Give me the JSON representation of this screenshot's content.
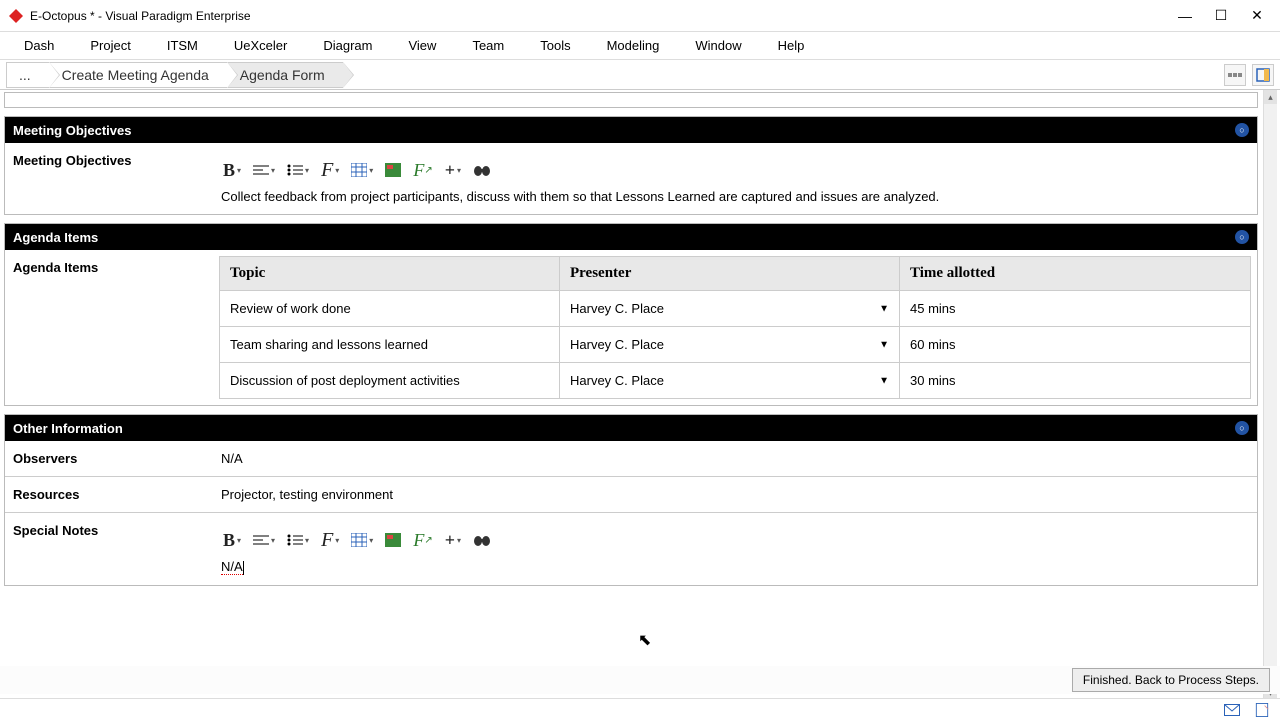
{
  "window": {
    "title": "E-Octopus * - Visual Paradigm Enterprise"
  },
  "menu": {
    "items": [
      "Dash",
      "Project",
      "ITSM",
      "UeXceler",
      "Diagram",
      "View",
      "Team",
      "Tools",
      "Modeling",
      "Window",
      "Help"
    ]
  },
  "breadcrumb": {
    "ellipsis": "...",
    "items": [
      "Create Meeting Agenda",
      "Agenda Form"
    ]
  },
  "sections": {
    "objectives": {
      "title": "Meeting Objectives",
      "label": "Meeting Objectives",
      "text": "Collect feedback from project participants, discuss with them so that Lessons Learned are captured and issues are analyzed."
    },
    "agenda": {
      "title": "Agenda Items",
      "label": "Agenda Items",
      "columns": {
        "topic": "Topic",
        "presenter": "Presenter",
        "time": "Time allotted"
      },
      "rows": [
        {
          "topic": "Review of work done",
          "presenter": "Harvey C. Place",
          "time": "45 mins"
        },
        {
          "topic": "Team sharing and lessons learned",
          "presenter": "Harvey C. Place",
          "time": "60 mins"
        },
        {
          "topic": "Discussion of post deployment activities",
          "presenter": "Harvey C. Place",
          "time": "30 mins"
        }
      ]
    },
    "other": {
      "title": "Other Information",
      "observers_label": "Observers",
      "observers_value": "N/A",
      "resources_label": "Resources",
      "resources_value": "Projector, testing environment",
      "notes_label": "Special Notes",
      "notes_value": "N/A"
    }
  },
  "footer": {
    "finish": "Finished. Back to Process Steps."
  }
}
